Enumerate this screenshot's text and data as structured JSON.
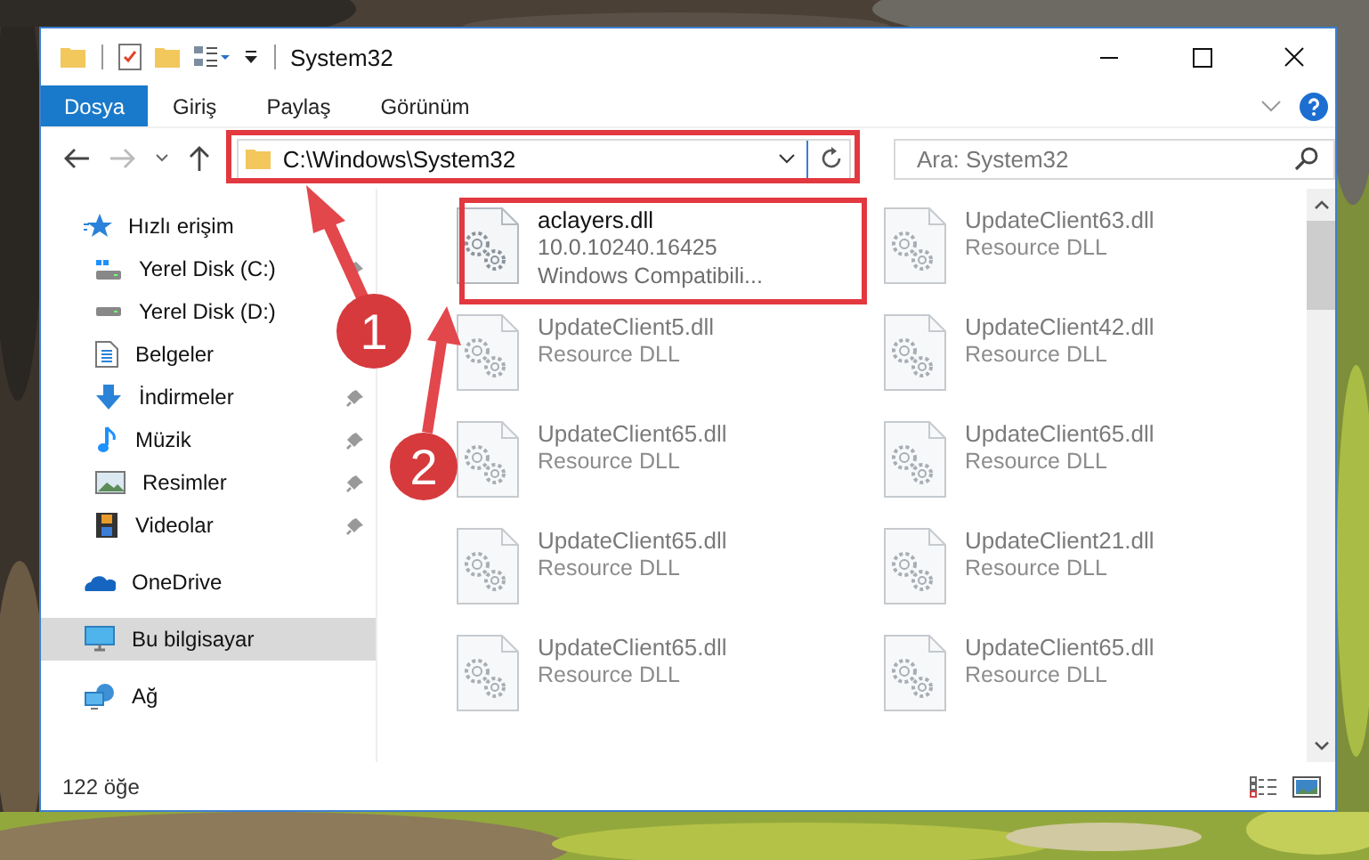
{
  "window": {
    "title": "System32"
  },
  "ribbon_tabs": [
    {
      "label": "Dosya",
      "selected": true
    },
    {
      "label": "Giriş",
      "selected": false
    },
    {
      "label": "Paylaş",
      "selected": false
    },
    {
      "label": "Görünüm",
      "selected": false
    }
  ],
  "address": {
    "path": "C:\\Windows\\System32"
  },
  "search": {
    "placeholder": "Ara: System32"
  },
  "sidebar": {
    "items": [
      {
        "label": "Hızlı erişim",
        "kind": "star",
        "selected": false,
        "children": [
          {
            "label": "Yerel Disk (C:)",
            "kind": "system-disk",
            "selected": false,
            "pinned": true
          },
          {
            "label": "Yerel Disk (D:)",
            "kind": "disk",
            "selected": false,
            "pinned": false
          },
          {
            "label": "Belgeler",
            "kind": "documents",
            "selected": false,
            "pinned": false
          },
          {
            "label": "İndirmeler",
            "kind": "download",
            "selected": false,
            "pinned": true
          },
          {
            "label": "Müzik",
            "kind": "music",
            "selected": false,
            "pinned": true
          },
          {
            "label": "Resimler",
            "kind": "pictures",
            "selected": false,
            "pinned": true
          },
          {
            "label": "Videolar",
            "kind": "videos",
            "selected": false,
            "pinned": true
          }
        ]
      },
      {
        "label": "OneDrive",
        "kind": "cloud",
        "selected": false
      },
      {
        "label": "Bu bilgisayar",
        "kind": "computer",
        "selected": true
      },
      {
        "label": "Ağ",
        "kind": "network",
        "selected": false
      }
    ]
  },
  "files": [
    {
      "name": "aclayers.dll",
      "details": [
        "10.0.10240.16425",
        "Windows Compatibili..."
      ],
      "dimmed": false
    },
    {
      "name": "UpdateClient63.dll",
      "details": [
        "Resource DLL"
      ],
      "dimmed": true
    },
    {
      "name": "UpdateClient5.dll",
      "details": [
        "Resource DLL"
      ],
      "dimmed": true
    },
    {
      "name": "UpdateClient42.dll",
      "details": [
        "Resource DLL"
      ],
      "dimmed": true
    },
    {
      "name": "UpdateClient65.dll",
      "details": [
        "Resource DLL"
      ],
      "dimmed": true
    },
    {
      "name": "UpdateClient65.dll",
      "details": [
        "Resource DLL"
      ],
      "dimmed": true
    },
    {
      "name": "UpdateClient65.dll",
      "details": [
        "Resource DLL"
      ],
      "dimmed": true
    },
    {
      "name": "UpdateClient21.dll",
      "details": [
        "Resource DLL"
      ],
      "dimmed": true
    },
    {
      "name": "UpdateClient65.dll",
      "details": [
        "Resource DLL"
      ],
      "dimmed": true
    },
    {
      "name": "UpdateClient65.dll",
      "details": [
        "Resource DLL"
      ],
      "dimmed": true
    }
  ],
  "status_bar": {
    "count": "122 öğe"
  },
  "callouts": [
    {
      "number": "1"
    },
    {
      "number": "2"
    }
  ]
}
